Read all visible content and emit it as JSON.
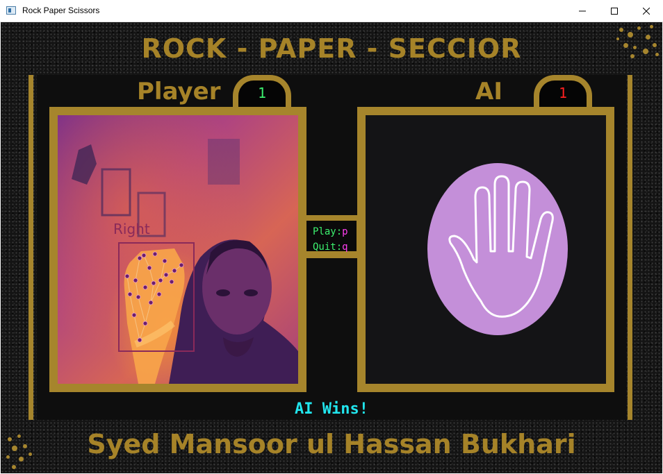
{
  "window": {
    "title": "Rock Paper Scissors"
  },
  "game": {
    "title": "ROCK - PAPER - SECCIOR",
    "player_label": "Player",
    "ai_label": "AI",
    "player_score": "1",
    "ai_score": "1",
    "hand_label": "Right",
    "controls": {
      "play_text": "Play:",
      "play_key": "p",
      "quit_text": "Quit:",
      "quit_key": "q"
    },
    "result": "AI Wins!",
    "author": "Syed Mansoor ul Hassan Bukhari"
  },
  "colors": {
    "gold": "#a6852c",
    "player_score": "#3cf06e",
    "ai_score": "#ff2020",
    "result": "#21e6ee",
    "key": "#ff3df0",
    "ai_gesture_bg": "#c48fd9"
  },
  "icons": {
    "ai_gesture": "open-hand-paper-icon"
  }
}
